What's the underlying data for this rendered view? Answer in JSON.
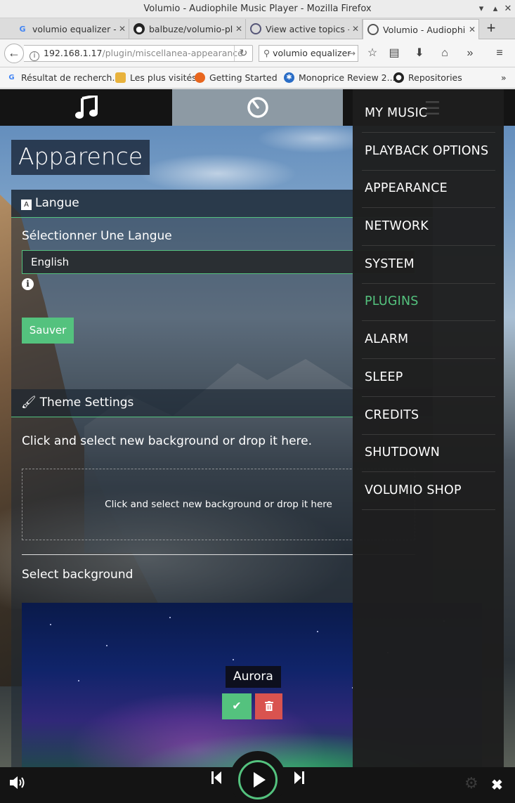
{
  "window": {
    "title": "Volumio - Audiophile Music Player - Mozilla Firefox"
  },
  "tabs": [
    {
      "label": "volumio equalizer -",
      "icon": "google-icon"
    },
    {
      "label": "balbuze/volumio-plu",
      "icon": "github-icon"
    },
    {
      "label": "View active topics -",
      "icon": "forum-icon"
    },
    {
      "label": "Volumio - Audiophile",
      "icon": "volumio-icon",
      "active": true
    }
  ],
  "navbar": {
    "url_host": "192.168.1.17",
    "url_path": "/plugin/miscellanea-appearance",
    "search_value": "volumio equalizer"
  },
  "bookmarks": [
    {
      "label": "Résultat de recherch...",
      "icon": "google-icon"
    },
    {
      "label": "Les plus visités",
      "icon": "folder-icon"
    },
    {
      "label": "Getting Started",
      "icon": "firefox-icon"
    },
    {
      "label": "Monoprice Review 2...",
      "icon": "bookmark-icon"
    },
    {
      "label": "Repositories",
      "icon": "github-icon"
    }
  ],
  "page": {
    "title": "Apparence",
    "language_section": {
      "header": "Langue",
      "select_label": "Sélectionner Une Langue",
      "selected_language": "English",
      "save_label": "Sauver"
    },
    "theme_section": {
      "header": "Theme Settings",
      "drop_text": "Click and select new background or drop it here.",
      "dropzone_text": "Click and select new background or drop it here",
      "select_background_label": "Select background",
      "current_background": "Aurora"
    }
  },
  "side_menu": {
    "items": [
      {
        "label": "MY MUSIC"
      },
      {
        "label": "PLAYBACK OPTIONS"
      },
      {
        "label": "APPEARANCE"
      },
      {
        "label": "NETWORK"
      },
      {
        "label": "SYSTEM"
      },
      {
        "label": "PLUGINS",
        "active": true
      },
      {
        "label": "ALARM"
      },
      {
        "label": "SLEEP"
      },
      {
        "label": "CREDITS"
      },
      {
        "label": "SHUTDOWN"
      },
      {
        "label": "VOLUMIO SHOP"
      }
    ]
  },
  "colors": {
    "accent": "#54c27e",
    "danger": "#d9534f",
    "menu_bg": "#1e1e1e"
  }
}
